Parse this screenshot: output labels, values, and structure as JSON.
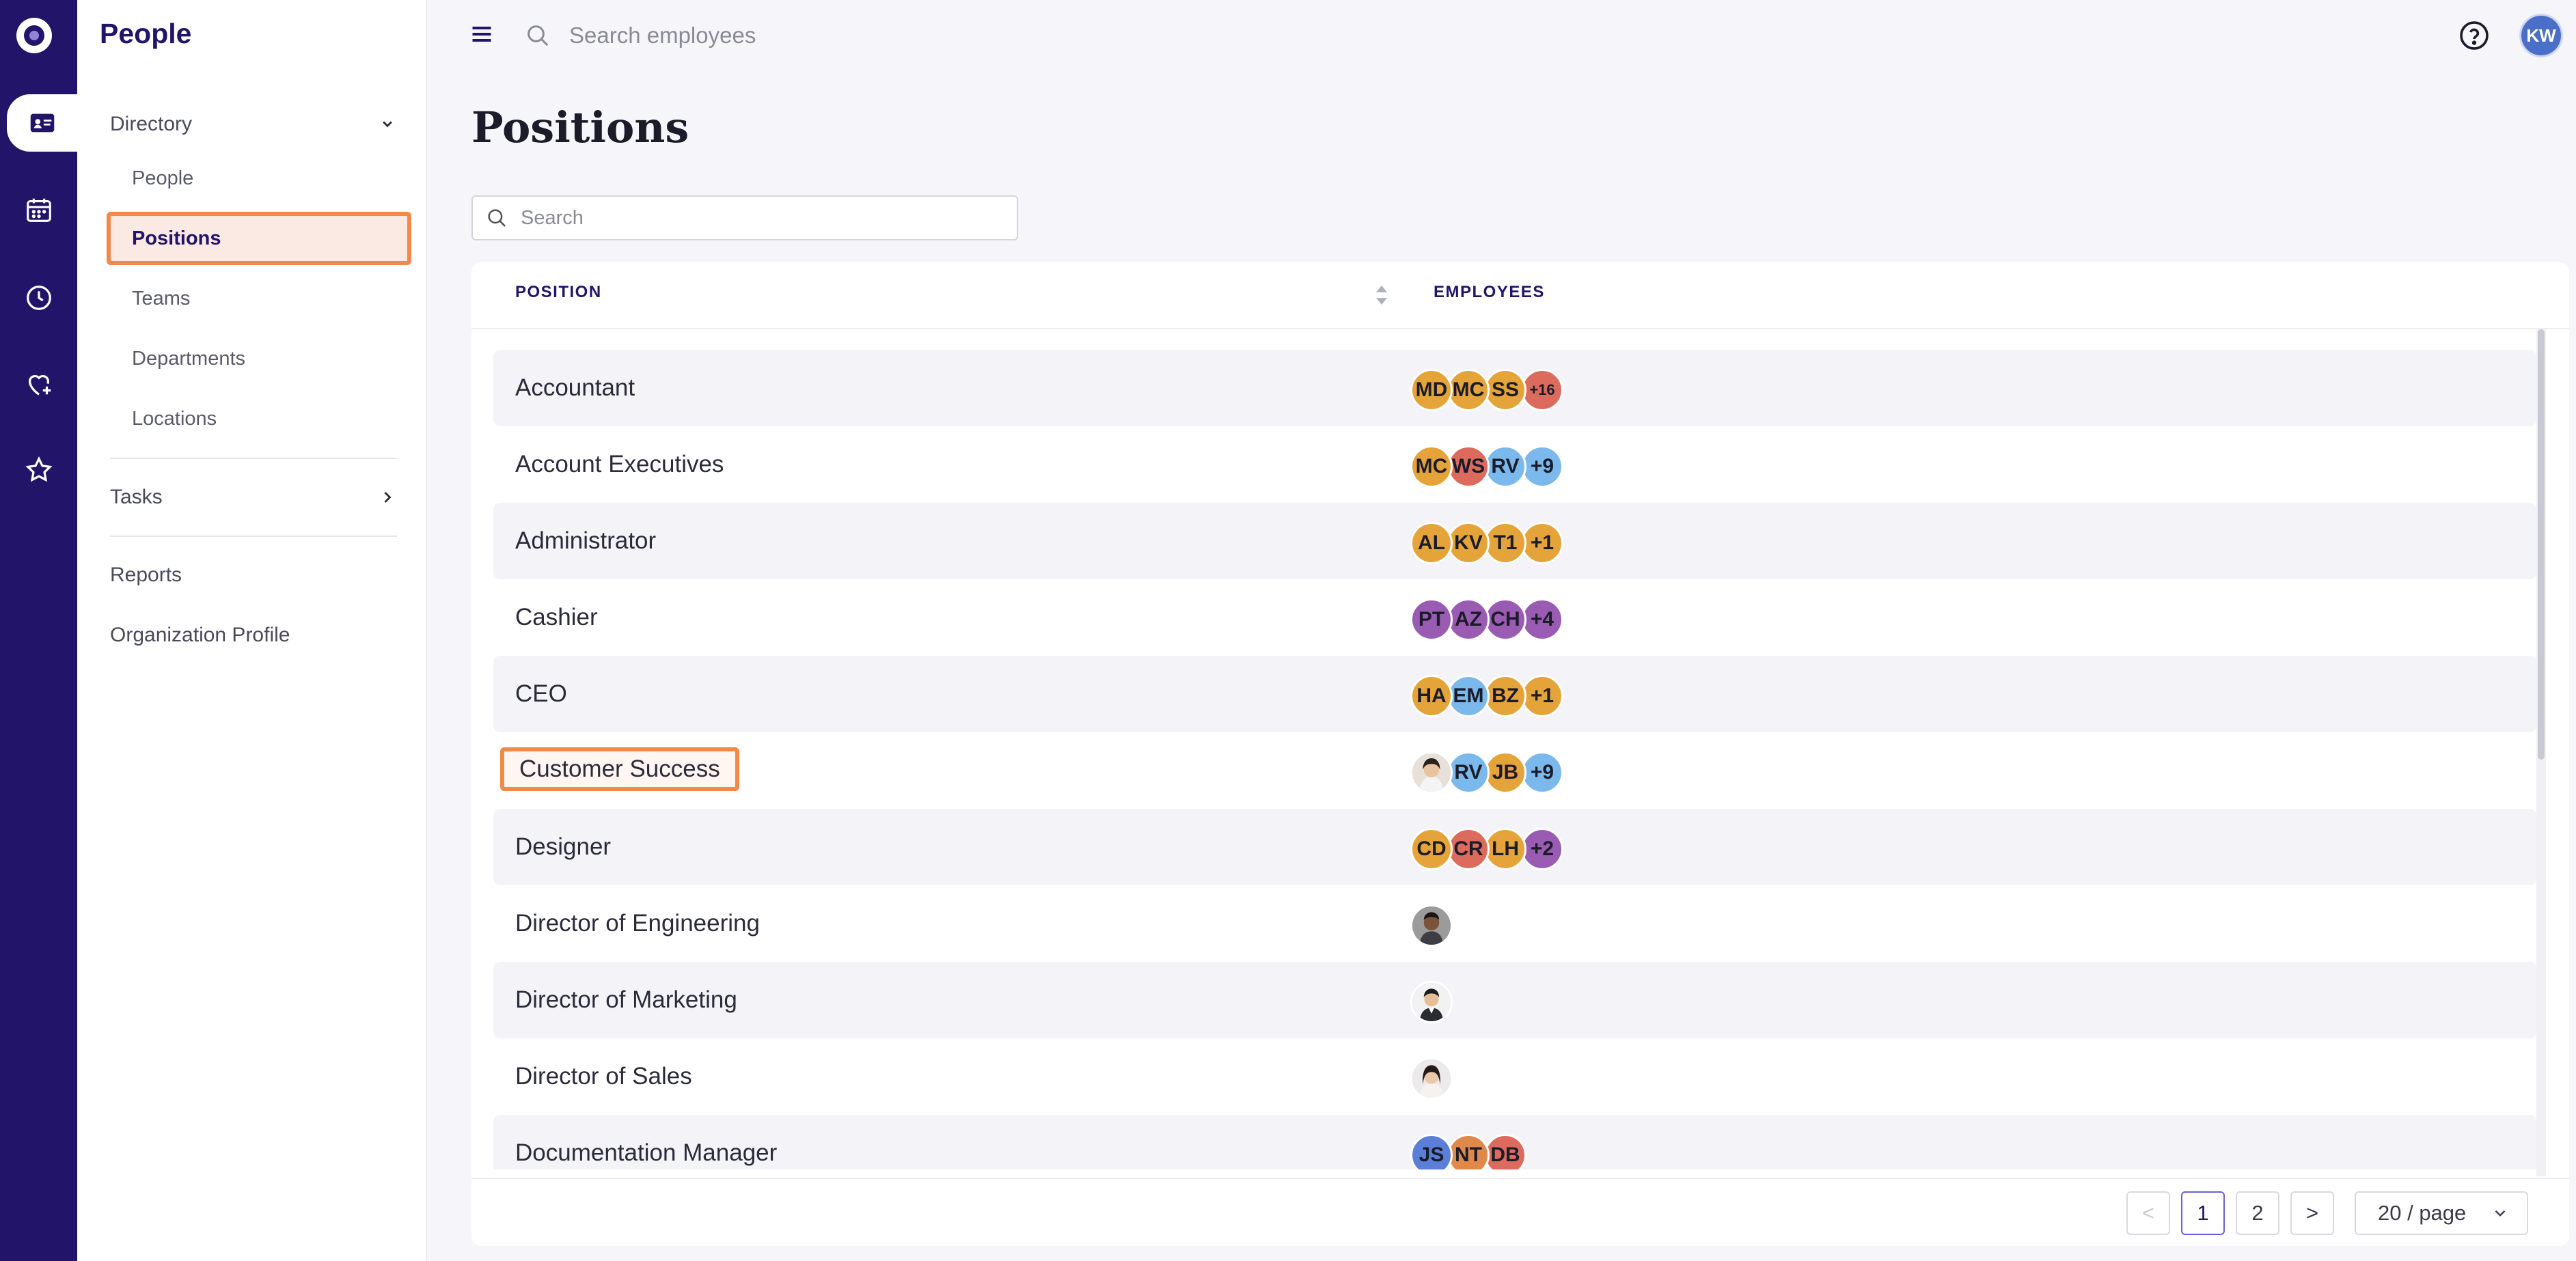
{
  "app": {
    "title": "People"
  },
  "user": {
    "initials": "KW"
  },
  "topbar": {
    "search_placeholder": "Search employees"
  },
  "sidebar": {
    "directory_label": "Directory",
    "directory_items": [
      {
        "label": "People"
      },
      {
        "label": "Positions"
      },
      {
        "label": "Teams"
      },
      {
        "label": "Departments"
      },
      {
        "label": "Locations"
      }
    ],
    "tasks_label": "Tasks",
    "reports_label": "Reports",
    "org_profile_label": "Organization Profile"
  },
  "page": {
    "title": "Positions",
    "search_placeholder": "Search"
  },
  "table": {
    "columns": {
      "position": "POSITION",
      "employees": "EMPLOYEES"
    },
    "rows": [
      {
        "position": "Accountant",
        "avatars": [
          {
            "text": "MD",
            "color": "#e5a43a"
          },
          {
            "text": "MC",
            "color": "#e5a43a"
          },
          {
            "text": "SS",
            "color": "#e5a43a"
          },
          {
            "text": "+16",
            "color": "#dd6b5d"
          }
        ]
      },
      {
        "position": "Account Executives",
        "avatars": [
          {
            "text": "MC",
            "color": "#e5a43a"
          },
          {
            "text": "WS",
            "color": "#dd6b5d"
          },
          {
            "text": "RV",
            "color": "#7bb8ec"
          },
          {
            "text": "+9",
            "color": "#7bb8ec"
          }
        ]
      },
      {
        "position": "Administrator",
        "avatars": [
          {
            "text": "AL",
            "color": "#e5a43a"
          },
          {
            "text": "KV",
            "color": "#e5a43a"
          },
          {
            "text": "T1",
            "color": "#e5a43a"
          },
          {
            "text": "+1",
            "color": "#e5a43a"
          }
        ]
      },
      {
        "position": "Cashier",
        "avatars": [
          {
            "text": "PT",
            "color": "#9a5bb3"
          },
          {
            "text": "AZ",
            "color": "#9a5bb3"
          },
          {
            "text": "CH",
            "color": "#9a5bb3"
          },
          {
            "text": "+4",
            "color": "#9a5bb3"
          }
        ]
      },
      {
        "position": "CEO",
        "avatars": [
          {
            "text": "HA",
            "color": "#e5a43a"
          },
          {
            "text": "EM",
            "color": "#7bb8ec"
          },
          {
            "text": "BZ",
            "color": "#e5a43a"
          },
          {
            "text": "+1",
            "color": "#e5a43a"
          }
        ]
      },
      {
        "position": "Customer Success",
        "avatars": [
          {
            "photo": "female-photo"
          },
          {
            "text": "RV",
            "color": "#7bb8ec"
          },
          {
            "text": "JB",
            "color": "#e5a43a"
          },
          {
            "text": "+9",
            "color": "#7bb8ec"
          }
        ]
      },
      {
        "position": "Designer",
        "avatars": [
          {
            "text": "CD",
            "color": "#e5a43a"
          },
          {
            "text": "CR",
            "color": "#dd6b5d"
          },
          {
            "text": "LH",
            "color": "#e5a43a"
          },
          {
            "text": "+2",
            "color": "#9a5bb3"
          }
        ]
      },
      {
        "position": "Director of Engineering",
        "avatars": [
          {
            "photo": "male-photo-dark"
          }
        ]
      },
      {
        "position": "Director of Marketing",
        "avatars": [
          {
            "photo": "male-photo"
          }
        ]
      },
      {
        "position": "Director of Sales",
        "avatars": [
          {
            "photo": "female-photo-2"
          }
        ]
      },
      {
        "position": "Documentation Manager",
        "avatars": [
          {
            "text": "JS",
            "color": "#5b7fd6"
          },
          {
            "text": "NT",
            "color": "#e0894a"
          },
          {
            "text": "DB",
            "color": "#dd6b5d"
          }
        ]
      }
    ]
  },
  "pagination": {
    "prev": "<",
    "pages": [
      "1",
      "2"
    ],
    "next": ">",
    "page_size": "20 / page"
  },
  "colors": {
    "rail": "#211469",
    "accent": "#211469",
    "highlight_border": "#f08a4b"
  }
}
